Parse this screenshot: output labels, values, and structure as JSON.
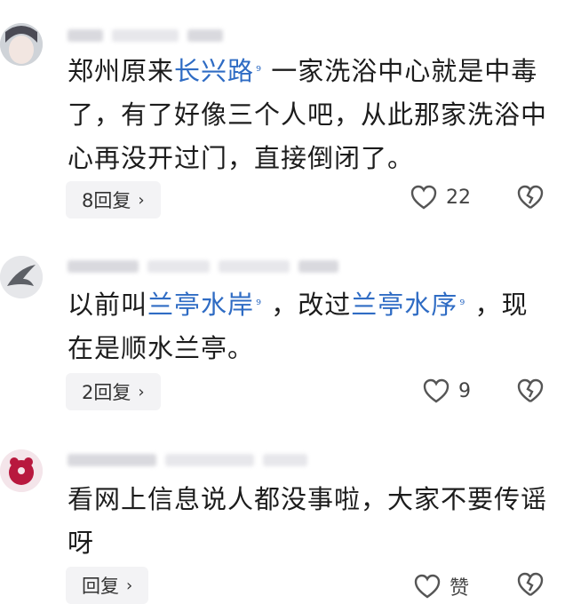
{
  "comments": [
    {
      "parts": [
        {
          "t": "郑州原来"
        },
        {
          "t": "长兴路",
          "link": true
        },
        {
          "t": " 一家洗浴中心就是中毒了，有了好像三个人吧，从此那家洗浴中心再没开过门，直接倒闭了。"
        }
      ],
      "replies_label": "8回复",
      "like_count": "22"
    },
    {
      "parts": [
        {
          "t": "以前叫"
        },
        {
          "t": "兰亭水岸",
          "link": true
        },
        {
          "t": " ，改过"
        },
        {
          "t": "兰亭水序",
          "link": true
        },
        {
          "t": " ，现在是顺水兰亭。"
        }
      ],
      "replies_label": "2回复",
      "like_count": "9"
    },
    {
      "parts": [
        {
          "t": "看网上信息说人都没事啦，大家不要传谣呀"
        }
      ],
      "replies_label": "回复",
      "like_count": "赞"
    }
  ],
  "colors": {
    "link": "#2f6cc4",
    "reply_bg": "#f3f3f5"
  },
  "icons": {
    "location_pin": "⁹",
    "chevron": "›"
  }
}
